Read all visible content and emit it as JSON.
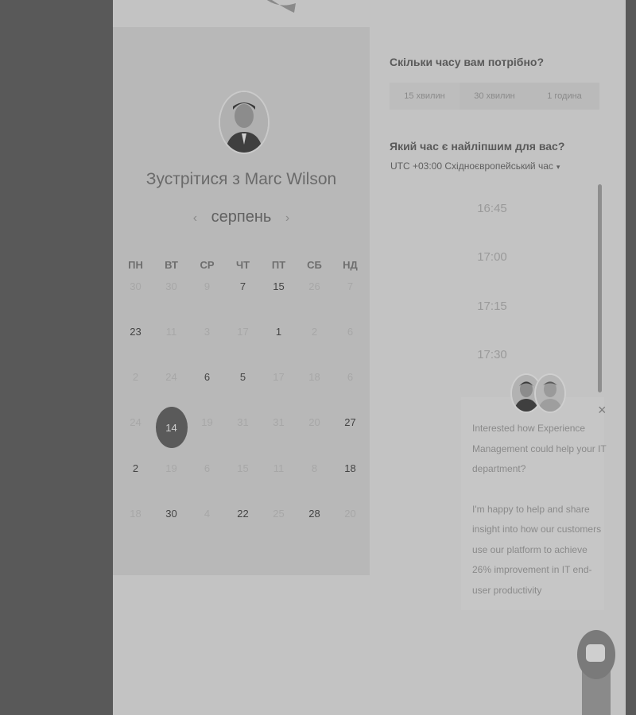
{
  "left": {
    "title": "Зустрітися з Marc Wilson",
    "month": "серпень",
    "prev_arrow": "‹",
    "next_arrow": "›",
    "weekdays": [
      "ПН",
      "ВТ",
      "СР",
      "ЧТ",
      "ПТ",
      "СБ",
      "НД"
    ],
    "weeks": [
      [
        {
          "d": "30",
          "a": false
        },
        {
          "d": "30",
          "a": false
        },
        {
          "d": "9",
          "a": false
        },
        {
          "d": "7",
          "a": true
        },
        {
          "d": "15",
          "a": true
        },
        {
          "d": "26",
          "a": false
        },
        {
          "d": "7",
          "a": false
        }
      ],
      [
        {
          "d": "23",
          "a": true
        },
        {
          "d": "11",
          "a": false
        },
        {
          "d": "3",
          "a": false
        },
        {
          "d": "17",
          "a": false
        },
        {
          "d": "1",
          "a": true
        },
        {
          "d": "2",
          "a": false
        },
        {
          "d": "6",
          "a": false
        }
      ],
      [
        {
          "d": "2",
          "a": false
        },
        {
          "d": "24",
          "a": false
        },
        {
          "d": "6",
          "a": true
        },
        {
          "d": "5",
          "a": true
        },
        {
          "d": "17",
          "a": false
        },
        {
          "d": "18",
          "a": false
        },
        {
          "d": "6",
          "a": false
        }
      ],
      [
        {
          "d": "24",
          "a": false
        },
        {
          "d": "14",
          "a": true,
          "sel": true
        },
        {
          "d": "19",
          "a": false
        },
        {
          "d": "31",
          "a": false
        },
        {
          "d": "31",
          "a": false
        },
        {
          "d": "20",
          "a": false
        },
        {
          "d": "27",
          "a": true
        }
      ],
      [
        {
          "d": "2",
          "a": true
        },
        {
          "d": "19",
          "a": false
        },
        {
          "d": "6",
          "a": false
        },
        {
          "d": "15",
          "a": false
        },
        {
          "d": "11",
          "a": false
        },
        {
          "d": "8",
          "a": false
        },
        {
          "d": "18",
          "a": true
        }
      ],
      [
        {
          "d": "18",
          "a": false
        },
        {
          "d": "30",
          "a": true
        },
        {
          "d": "4",
          "a": false
        },
        {
          "d": "22",
          "a": true
        },
        {
          "d": "25",
          "a": false
        },
        {
          "d": "28",
          "a": true
        },
        {
          "d": "20",
          "a": false
        }
      ]
    ]
  },
  "right": {
    "duration_question": "Скільки часу вам потрібно?",
    "durations": [
      "15 хвилин",
      "30 хвилин",
      "1 година"
    ],
    "time_question": "Який час є найліпшим для вас?",
    "timezone": "UTC +03:00 Східноєвропейський час",
    "timezone_caret": "▾",
    "slots": [
      "16:45",
      "17:00",
      "17:15",
      "17:30"
    ]
  },
  "chat": {
    "close": "×",
    "message_1": "Interested how Experience Management could help your IT department?",
    "message_2": "I'm happy to help and share insight into how our customers use our platform to achieve 26% improvement in IT end-user productivity"
  }
}
